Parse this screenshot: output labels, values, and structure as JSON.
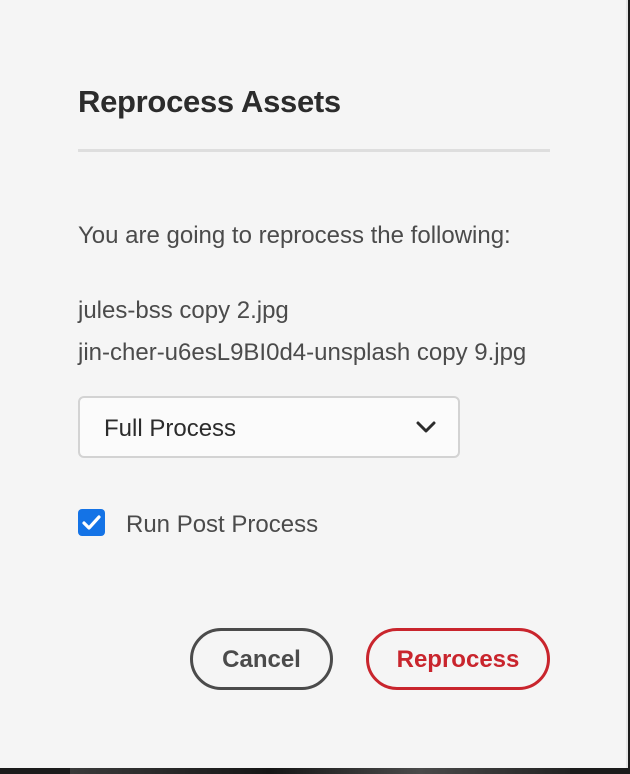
{
  "dialog": {
    "title": "Reprocess Assets",
    "intro": "You are going to reprocess the following:",
    "assets": [
      "jules-bss copy 2.jpg",
      "jin-cher-u6esL9BI0d4-unsplash copy 9.jpg"
    ],
    "process_select": {
      "value": "Full Process",
      "icon": "chevron-down-icon"
    },
    "run_post_process": {
      "label": "Run Post Process",
      "checked": true
    },
    "buttons": {
      "cancel_label": "Cancel",
      "reprocess_label": "Reprocess"
    }
  },
  "colors": {
    "accent_blue": "#1473e6",
    "negative_red": "#c9252d",
    "text": "#4b4b4b",
    "dialog_bg": "#f5f5f5"
  }
}
